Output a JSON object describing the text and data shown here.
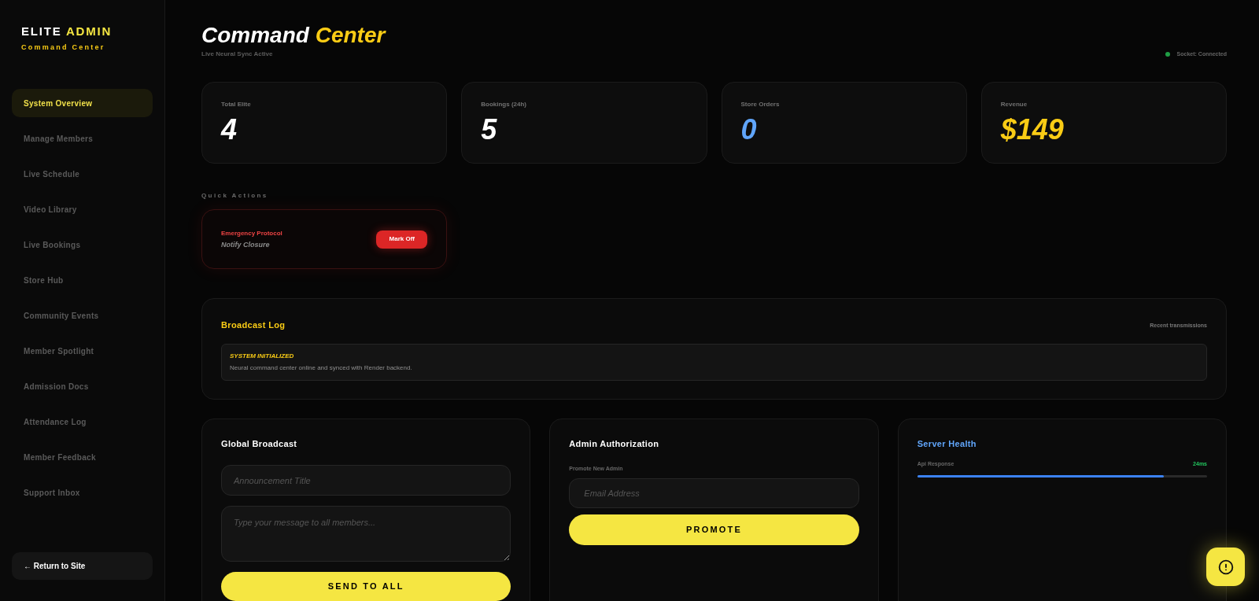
{
  "sidebar": {
    "brand": {
      "word_1": "ELITE",
      "word_2": "ADMIN",
      "tagline": "Command Center"
    },
    "items": [
      {
        "label": "System Overview",
        "selected": true
      },
      {
        "label": "Manage Members",
        "selected": false
      },
      {
        "label": "Live Schedule",
        "selected": false
      },
      {
        "label": "Video Library",
        "selected": false
      },
      {
        "label": "Live Bookings",
        "selected": false
      },
      {
        "label": "Store Hub",
        "selected": false
      },
      {
        "label": "Community Events",
        "selected": false
      },
      {
        "label": "Member Spotlight",
        "selected": false
      },
      {
        "label": "Admission Docs",
        "selected": false
      },
      {
        "label": "Attendance Log",
        "selected": false
      },
      {
        "label": "Member Feedback",
        "selected": false
      },
      {
        "label": "Support Inbox",
        "selected": false
      }
    ],
    "return_link": "← Return to Site"
  },
  "header": {
    "title_1": "Command",
    "title_2": "Center",
    "subtitle": "Live Neural Sync Active",
    "socket": {
      "label": "Socket: Connected",
      "connected": true
    }
  },
  "stats": [
    {
      "label": "Total Elite",
      "value": "4",
      "color": "#ffffff"
    },
    {
      "label": "Bookings (24h)",
      "value": "5",
      "color": "#ffffff"
    },
    {
      "label": "Store Orders",
      "value": "0",
      "color": "#60a5fa"
    },
    {
      "label": "Revenue",
      "value": "$149",
      "color": "#facc15"
    }
  ],
  "quick_actions": {
    "heading": "Quick Actions",
    "items": [
      {
        "title": "Emergency Protocol",
        "subtitle": "Notify Closure",
        "button": "Mark Off"
      }
    ]
  },
  "broadcast_log": {
    "title": "Broadcast Log",
    "caption": "Recent transmissions",
    "entries": [
      {
        "title": "SYSTEM INITIALIZED",
        "message": "Neural command center online and synced with Render backend."
      }
    ]
  },
  "global_broadcast": {
    "title": "Global Broadcast",
    "title_field": {
      "placeholder": "Announcement Title"
    },
    "message_field": {
      "placeholder": "Type your message to all members..."
    },
    "button": "SEND TO ALL"
  },
  "admin_authorization": {
    "title": "Admin Authorization",
    "field_label": "Promote New Admin",
    "email_field": {
      "placeholder": "Email Address"
    },
    "button": "PROMOTE"
  },
  "server_health": {
    "title": "Server Health",
    "metrics": [
      {
        "label": "Api Response",
        "reading": "24ms",
        "level": 0.85
      }
    ]
  },
  "help_button": {
    "visible": true
  }
}
